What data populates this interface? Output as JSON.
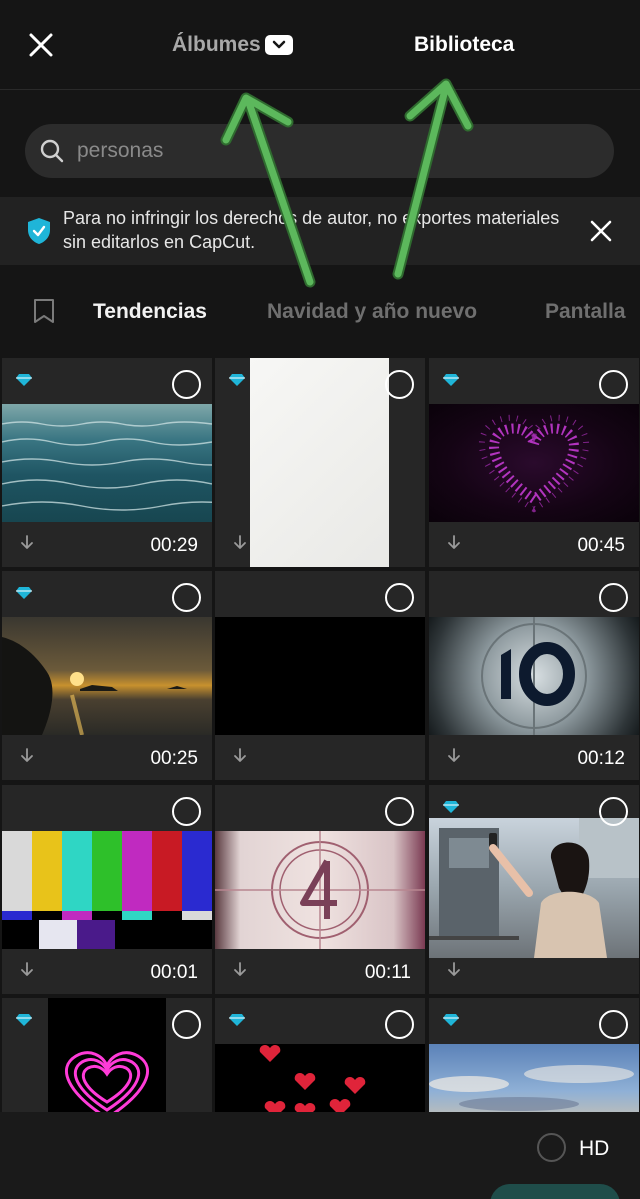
{
  "header": {
    "tab_albums": "Álbumes",
    "tab_library": "Biblioteca"
  },
  "search": {
    "placeholder": "personas"
  },
  "notice": {
    "text": "Para no infringir los derechos de autor, no exportes materiales sin editarlos en CapCut."
  },
  "categories": [
    "Tendencias",
    "Navidad y año nuevo",
    "Pantalla"
  ],
  "grid": {
    "tiles": [
      {
        "premium": true,
        "duration": "00:29",
        "thumb": "sea-waves"
      },
      {
        "premium": true,
        "duration": "",
        "thumb": "white-paper"
      },
      {
        "premium": true,
        "duration": "00:45",
        "thumb": "particle-heart"
      },
      {
        "premium": true,
        "duration": "00:25",
        "thumb": "sunset-coast"
      },
      {
        "premium": false,
        "duration": "",
        "thumb": "black"
      },
      {
        "premium": false,
        "duration": "00:12",
        "thumb": "countdown-10"
      },
      {
        "premium": false,
        "duration": "00:01",
        "thumb": "color-bars"
      },
      {
        "premium": false,
        "duration": "00:11",
        "thumb": "film-countdown-4"
      },
      {
        "premium": true,
        "duration": "",
        "thumb": "selfie-woman"
      },
      {
        "premium": true,
        "duration": "",
        "thumb": "neon-heart"
      },
      {
        "premium": true,
        "duration": "",
        "thumb": "red-hearts"
      },
      {
        "premium": true,
        "duration": "",
        "thumb": "sky-clouds"
      }
    ]
  },
  "footer": {
    "hd_label": "HD"
  },
  "colors": {
    "accent": "#1fb5d8",
    "annotation_arrow": "#5cb85c"
  }
}
